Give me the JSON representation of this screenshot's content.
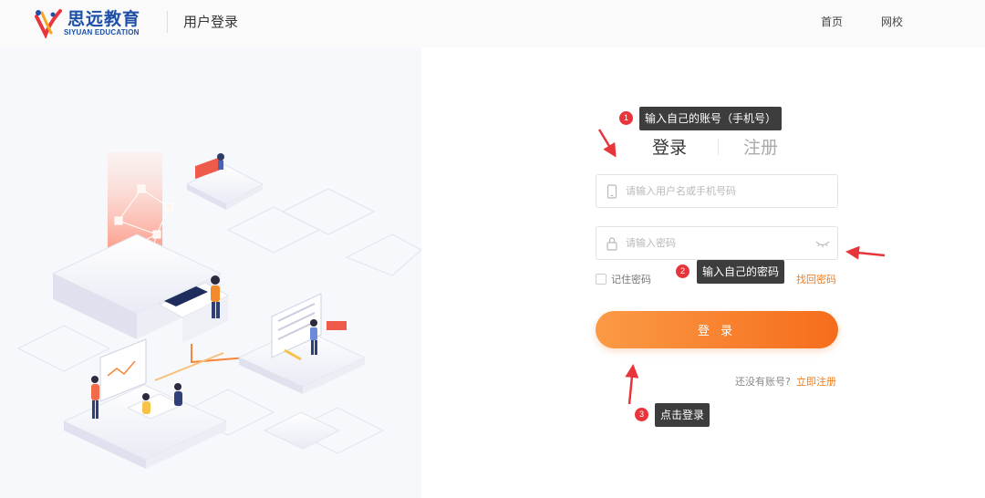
{
  "header": {
    "logo_cn": "思远教育",
    "logo_en": "SIYUAN EDUCATION",
    "title": "用户登录",
    "nav": [
      "首页",
      "网校"
    ]
  },
  "form": {
    "tabs": [
      "登录",
      "注册"
    ],
    "active_tab": "登录",
    "username_placeholder": "请输入用户名或手机号码",
    "password_placeholder": "请输入密码",
    "remember_label": "记住密码",
    "remember_checked": false,
    "forgot_label": "找回密码",
    "submit_label": "登 录",
    "no_account_text": "还没有账号?",
    "register_now_label": "立即注册"
  },
  "annotations": [
    {
      "num": "1",
      "text": "输入自己的账号（手机号）"
    },
    {
      "num": "2",
      "text": "输入自己的密码"
    },
    {
      "num": "3",
      "text": "点击登录"
    }
  ],
  "colors": {
    "accent": "#f56d1c",
    "accent_light": "#fb9a45",
    "brand_blue": "#1d4fa8",
    "annotation_bg": "#3d3d3d",
    "annotation_num": "#e8353b",
    "arrow": "#e8353b"
  },
  "icons": {
    "username": "phone-icon",
    "password": "lock-icon",
    "toggle": "eye-icon"
  }
}
